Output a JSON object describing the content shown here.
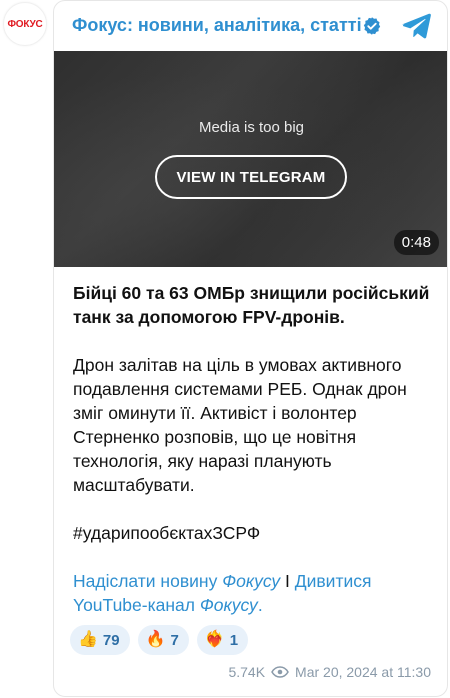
{
  "avatar": {
    "logo_text": "ФОКУС"
  },
  "header": {
    "channel_title": "Фокус: новини, аналітика, статті"
  },
  "media": {
    "message": "Media is too big",
    "button_label": "VIEW IN TELEGRAM",
    "duration": "0:48"
  },
  "post": {
    "headline": "Бійці 60 та 63 ОМБр знищили російський танк за допомогою FPV-дронів.",
    "paragraph": "Дрон залітав на ціль в умовах активного подавлення системами РЕБ. Однак дрон зміг оминути її. Активіст і волонтер Стерненко розповів, що це новітня технологія, яку наразі планують масштабувати.",
    "hashtag": "#ударипообєктахЗСРФ"
  },
  "links": {
    "link1_text": "Надіслати новину ",
    "link1_italic": "Фокусу",
    "separator": " I ",
    "link2_text": "Дивитися YouTube-канал ",
    "link2_italic": "Фокусу",
    "link2_end": "."
  },
  "reactions": [
    {
      "emoji": "👍",
      "count": "79"
    },
    {
      "emoji": "🔥",
      "count": "7"
    },
    {
      "emoji": "❤️‍🔥",
      "count": "1"
    }
  ],
  "footer": {
    "views": "5.74K",
    "timestamp": "Mar 20, 2024 at 11:30"
  },
  "colors": {
    "accent": "#2f8fd0",
    "brand_red": "#e01a22"
  }
}
